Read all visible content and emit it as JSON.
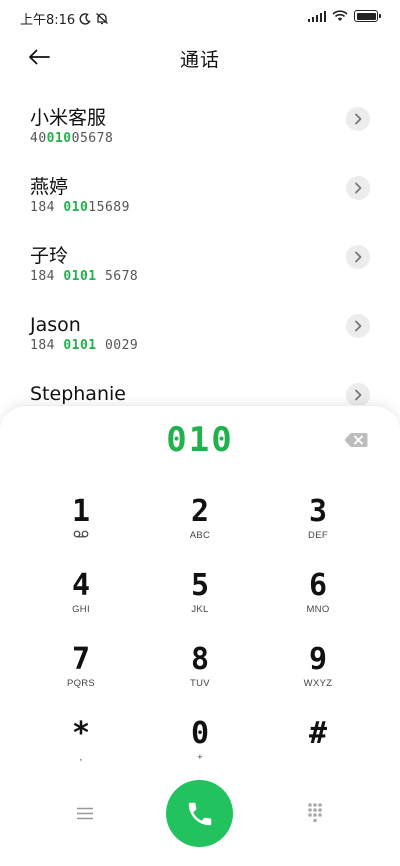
{
  "status_bar": {
    "time": "上午8:16",
    "icons": [
      "moon-icon",
      "muted-icon",
      "signal-icon",
      "wifi-icon",
      "battery-icon"
    ],
    "battery_label": "100"
  },
  "header": {
    "title": "通话",
    "back_icon": "arrow-left-icon"
  },
  "contacts": [
    {
      "name": "小米客服",
      "number_parts": [
        "40",
        "010",
        "05678"
      ]
    },
    {
      "name": "燕婷",
      "number_parts": [
        "184 ",
        "010",
        "15689"
      ]
    },
    {
      "name": "子玲",
      "number_parts": [
        "184 ",
        "0101",
        " 5678"
      ]
    },
    {
      "name": "Jason",
      "number_parts": [
        "184 ",
        "0101",
        " 0029"
      ]
    },
    {
      "name": "Stephanie",
      "number_parts": [
        "",
        "",
        ""
      ]
    }
  ],
  "dialer": {
    "dialed_number": "010",
    "keys": [
      {
        "digit": "1",
        "letters": ""
      },
      {
        "digit": "2",
        "letters": "ABC"
      },
      {
        "digit": "3",
        "letters": "DEF"
      },
      {
        "digit": "4",
        "letters": "GHI"
      },
      {
        "digit": "5",
        "letters": "JKL"
      },
      {
        "digit": "6",
        "letters": "MNO"
      },
      {
        "digit": "7",
        "letters": "PQRS"
      },
      {
        "digit": "8",
        "letters": "TUV"
      },
      {
        "digit": "9",
        "letters": "WXYZ"
      },
      {
        "digit": "*",
        "letters": ","
      },
      {
        "digit": "0",
        "letters": "+"
      },
      {
        "digit": "#",
        "letters": ""
      }
    ]
  },
  "colors": {
    "accent_green": "#22b14c",
    "call_button": "#22c35e",
    "text_primary": "#111111",
    "text_secondary": "#555555"
  }
}
